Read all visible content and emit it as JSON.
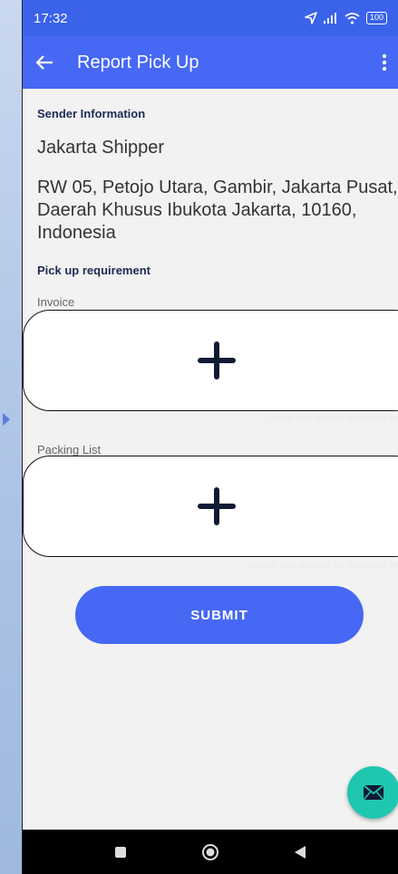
{
  "status_bar": {
    "time": "17:32",
    "battery": "100"
  },
  "app_bar": {
    "title": "Report Pick Up"
  },
  "sender": {
    "section_title": "Sender Information",
    "name": "Jakarta Shipper",
    "address": "RW 05, Petojo Utara, Gambir, Jakarta Pusat, Daerah Khusus Ibukota Jakarta, 10160, Indonesia"
  },
  "requirements": {
    "section_title": "Pick up requirement",
    "invoice": {
      "label": "Invoice",
      "hint": "Upload your invoice document here"
    },
    "packing_list": {
      "label": "Packing List",
      "hint": "Upload your packing list document here"
    }
  },
  "actions": {
    "submit_label": "SUBMIT"
  },
  "colors": {
    "primary": "#4668f4",
    "status_bar": "#3a63ea",
    "fab": "#1fc7b0"
  },
  "icons": [
    "back-arrow-icon",
    "more-vert-icon",
    "plus-icon",
    "mail-icon",
    "nav-recents-icon",
    "nav-home-icon",
    "nav-back-icon"
  ]
}
